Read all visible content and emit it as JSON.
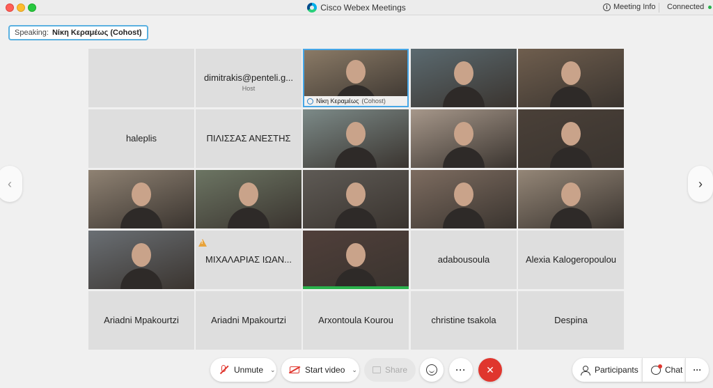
{
  "window": {
    "title": "Cisco Webex Meetings",
    "meeting_info": "Meeting Info",
    "status": "Connected"
  },
  "speaking": {
    "prefix": "Speaking:",
    "name": "Νίκη Κεραμέως (Cohost)"
  },
  "tiles": [
    {
      "label": "",
      "sub": "",
      "kind": "empty"
    },
    {
      "label": "dimitrakis@penteli.g...",
      "sub": "Host",
      "kind": "name"
    },
    {
      "label": "Νίκη Κεραμέως",
      "sub": "(Cohost)",
      "kind": "video-active"
    },
    {
      "label": "",
      "sub": "",
      "kind": "video"
    },
    {
      "label": "",
      "sub": "",
      "kind": "video"
    },
    {
      "label": "haleplis",
      "sub": "",
      "kind": "name"
    },
    {
      "label": "ΠΙΛΙΣΣΑΣ ΑΝΕΣΤΗΣ",
      "sub": "",
      "kind": "name"
    },
    {
      "label": "",
      "sub": "",
      "kind": "video"
    },
    {
      "label": "",
      "sub": "",
      "kind": "video"
    },
    {
      "label": "",
      "sub": "",
      "kind": "video"
    },
    {
      "label": "",
      "sub": "",
      "kind": "video"
    },
    {
      "label": "",
      "sub": "",
      "kind": "video"
    },
    {
      "label": "",
      "sub": "",
      "kind": "video"
    },
    {
      "label": "",
      "sub": "",
      "kind": "video"
    },
    {
      "label": "",
      "sub": "",
      "kind": "video"
    },
    {
      "label": "",
      "sub": "",
      "kind": "video"
    },
    {
      "label": "ΜΙΧΑΛΑΡΙΑΣ ΙΩΑΝ...",
      "sub": "",
      "kind": "name-warn"
    },
    {
      "label": "",
      "sub": "",
      "kind": "video-green"
    },
    {
      "label": "adabousoula",
      "sub": "",
      "kind": "name"
    },
    {
      "label": "Alexia Kalogeropoulou",
      "sub": "",
      "kind": "name"
    },
    {
      "label": "Ariadni Mpakourtzi",
      "sub": "",
      "kind": "name"
    },
    {
      "label": "Ariadni Mpakourtzi",
      "sub": "",
      "kind": "name"
    },
    {
      "label": "Arxontoula Kourou",
      "sub": "",
      "kind": "name"
    },
    {
      "label": "christine tsakola",
      "sub": "",
      "kind": "name"
    },
    {
      "label": "Despina",
      "sub": "",
      "kind": "name"
    }
  ],
  "controls": {
    "unmute": "Unmute",
    "start_video": "Start video",
    "share": "Share",
    "participants": "Participants",
    "chat": "Chat"
  },
  "colors": {
    "leave": "#e0362e",
    "active_border": "#46a6e6",
    "status_green": "#2ab24c"
  }
}
